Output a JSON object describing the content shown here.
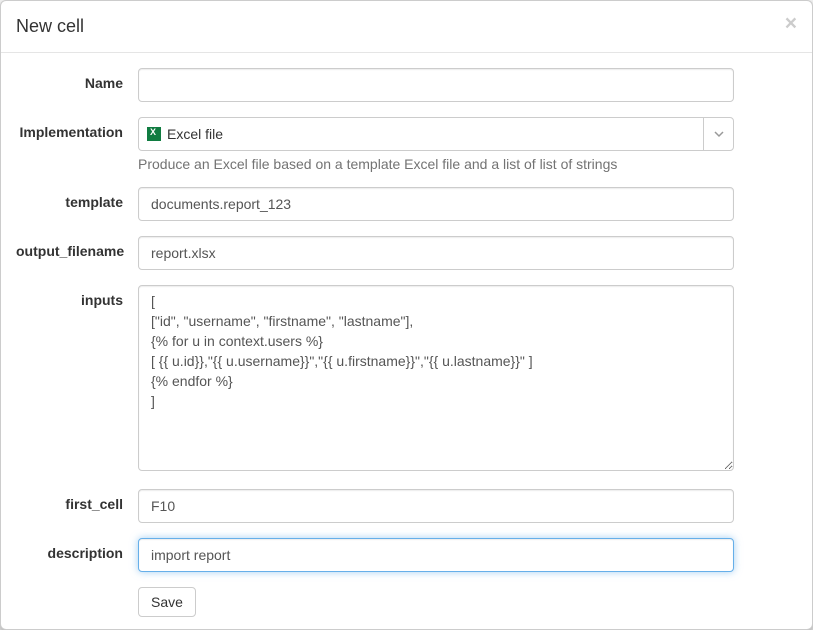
{
  "header": {
    "title": "New cell",
    "close_label": "×"
  },
  "form": {
    "name": {
      "label": "Name",
      "value": ""
    },
    "implementation": {
      "label": "Implementation",
      "selected": "Excel file",
      "help": "Produce an Excel file based on a template Excel file and a list of list of strings"
    },
    "template": {
      "label": "template",
      "value": "documents.report_123"
    },
    "output_filename": {
      "label": "output_filename",
      "value": "report.xlsx"
    },
    "inputs": {
      "label": "inputs",
      "value": "[\n[\"id\", \"username\", \"firstname\", \"lastname\"],\n{% for u in context.users %}\n[ {{ u.id}},\"{{ u.username}}\",\"{{ u.firstname}}\",\"{{ u.lastname}}\" ]\n{% endfor %}\n]"
    },
    "first_cell": {
      "label": "first_cell",
      "value": "F10"
    },
    "description": {
      "label": "description",
      "value": "import report"
    },
    "save_label": "Save"
  }
}
